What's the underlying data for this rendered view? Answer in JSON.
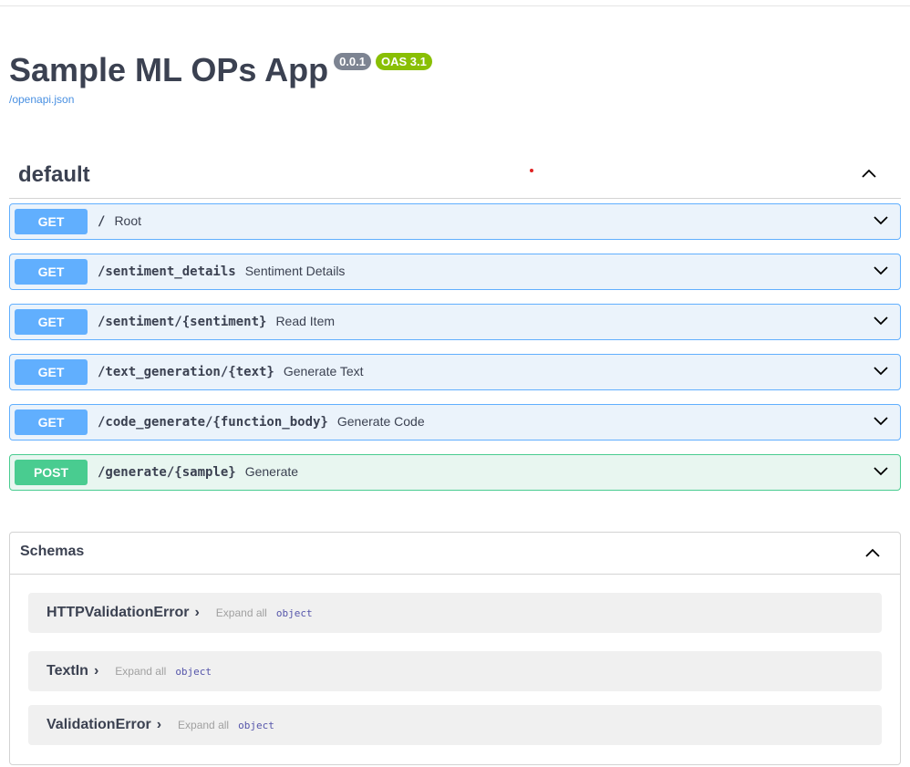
{
  "info": {
    "title": "Sample ML OPs App",
    "version": "0.0.1",
    "oas": "OAS 3.1",
    "spec_link": "/openapi.json"
  },
  "section": {
    "title": "default"
  },
  "operations": [
    {
      "method": "GET",
      "path": "/",
      "summary": "Root"
    },
    {
      "method": "GET",
      "path": "/sentiment_details",
      "summary": "Sentiment Details"
    },
    {
      "method": "GET",
      "path": "/sentiment/{sentiment}",
      "summary": "Read Item"
    },
    {
      "method": "GET",
      "path": "/text_generation/{text}",
      "summary": "Generate Text"
    },
    {
      "method": "GET",
      "path": "/code_generate/{function_body}",
      "summary": "Generate Code"
    },
    {
      "method": "POST",
      "path": "/generate/{sample}",
      "summary": "Generate"
    }
  ],
  "schemas": {
    "title": "Schemas",
    "models": [
      {
        "name": "HTTPValidationError",
        "expand_label": "Expand all",
        "type": "object"
      },
      {
        "name": "TextIn",
        "expand_label": "Expand all",
        "type": "object"
      },
      {
        "name": "ValidationError",
        "expand_label": "Expand all",
        "type": "object"
      }
    ]
  },
  "icons": {
    "collapse": "chevron-up-icon",
    "expand": "chevron-down-icon",
    "model-expand": "chevron-right-icon"
  },
  "colors": {
    "get": "#61affe",
    "post": "#49cc90",
    "version_badge": "#7d8492",
    "oas_badge": "#89bf04",
    "link": "#4990e2"
  }
}
